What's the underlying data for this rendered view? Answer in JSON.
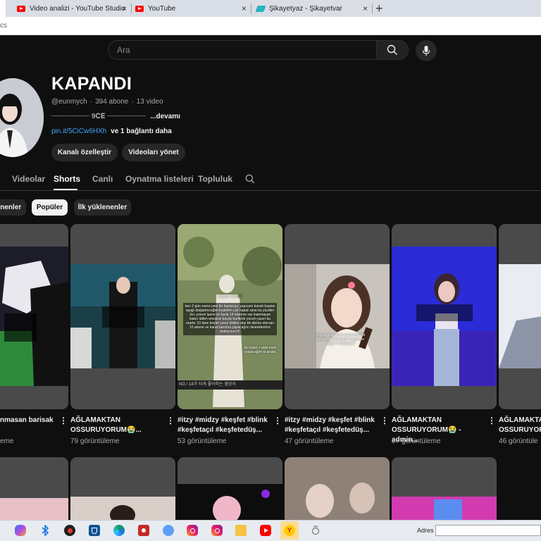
{
  "browser": {
    "tabs": [
      {
        "label": "Video analizi - YouTube Studio",
        "icon": "youtube-icon"
      },
      {
        "label": "YouTube",
        "icon": "youtube-icon"
      },
      {
        "label": "Şikayetyaz - Şikayetvar",
        "icon": "sikayetvar-icon"
      }
    ],
    "new_tab_glyph": "+",
    "close_glyph": "×",
    "address_fragment": "cs"
  },
  "search": {
    "placeholder": "Ara"
  },
  "channel": {
    "name": "KAPANDI",
    "handle": "@eunmych",
    "subscribers": "394 abone",
    "videos": "13 video",
    "separator": "·",
    "description": "┈┈┈┈┈┈┈┈┈ 𝟗𝐂𝐄 ┈┈┈┈┈┈┈┈┈",
    "description_more": "...devamı",
    "link": "pin.it/5CiCw6HXh",
    "link_extra": "ve 1 bağlantı daha",
    "customize_button": "Kanalı özelleştir",
    "manage_button": "Videoları yönet"
  },
  "tabs": [
    {
      "label": "Videolar",
      "active": false
    },
    {
      "label": "Shorts",
      "active": true
    },
    {
      "label": "Canlı",
      "active": false
    },
    {
      "label": "Oynatma listeleri",
      "active": false
    },
    {
      "label": "Topluluk",
      "active": false
    }
  ],
  "chips": [
    {
      "label": "enenler",
      "active": false
    },
    {
      "label": "Popüler",
      "active": true
    },
    {
      "label": "İlk yüklenenler",
      "active": false
    }
  ],
  "shorts": [
    {
      "title": "nmasan barisak",
      "views": "eme"
    },
    {
      "title": "AĞLAMAKTAN\nOSSURUYORUM😭...",
      "views": "79 görüntüleme"
    },
    {
      "title": "#itzy #midzy #keşfet #blink\n#keşfetaçıl #keşfetedüş...",
      "views": "53 görüntüleme",
      "overlay_top": "Selam! Yeo!!🌿",
      "overlay_main": "ben 2 gün sonra yeni bir başlangıç yapıcam kanalı baştan aşağı değiştireceğim keşfetim çok kapalı ama bu yüzden 1k+ yorum lazım en fazla 14 izlenme var inanmayan bakın lütfen emojisiz büyük harflerle yorum yazın bu arada: 10 tane keşfet yazıp dislike ahp bk abone olursan 10 abone ve kanal tanıtma yapacağım desteklerinizi bekliyorum!!!",
      "overlay_small": "ok kalan + abla nasıl yapacağım ki arada",
      "overlay_bottom": "NG /      18가 되게 좋아하는 영상이"
    },
    {
      "title": "#itzy #midzy #keşfet #blink\n#keşfetaçıl #keşfetedüş...",
      "views": "47 görüntüleme",
      "overlay_main": "Hiross: Cocuk bu saçını hat kat beyaz pantolonumu reagesine yapar 4 •Kararsız!"
    },
    {
      "title": "AĞLAMAKTAN\nOSSURUYORUM😭 -admin...",
      "views": "57 görüntüleme"
    },
    {
      "title": "AĞLAMAKTAN\nOSSURUYORU",
      "views": "46 görüntüle"
    }
  ],
  "taskbar": {
    "address_label": "Adres",
    "icons": [
      "copilot-icon",
      "bluetooth-icon",
      "game-icon",
      "defender-icon",
      "edge-icon",
      "recorder-icon",
      "app-icon",
      "instagram-icon",
      "instagram-icon",
      "folder-icon",
      "youtube-icon",
      "yandex-icon",
      "tiktok-icon"
    ]
  },
  "colors": {
    "background": "#0f0f0f",
    "link": "#3ea6ff",
    "chip_active": "#f1f1f1",
    "card_placeholder": "#4a4a4a"
  }
}
